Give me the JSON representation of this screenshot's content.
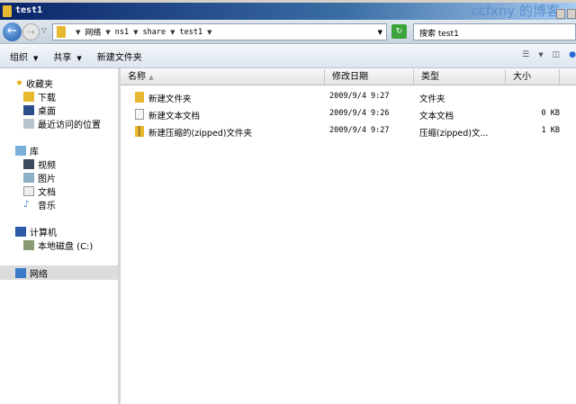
{
  "window": {
    "title": "test1",
    "watermark": "ccfxny 的博客"
  },
  "address": {
    "segments": [
      "网络",
      "ns1",
      "share",
      "test1"
    ],
    "search_placeholder": "搜索 test1"
  },
  "toolbar": {
    "organize": "组织",
    "share": "共享",
    "new_folder": "新建文件夹"
  },
  "nav": {
    "favorites": "收藏夹",
    "downloads": "下载",
    "desktop": "桌面",
    "recent": "最近访问的位置",
    "libraries": "库",
    "videos": "视频",
    "pictures": "图片",
    "documents": "文档",
    "music": "音乐",
    "computer": "计算机",
    "local_disk": "本地磁盘 (C:)",
    "network": "网络"
  },
  "columns": {
    "name": "名称",
    "date": "修改日期",
    "type": "类型",
    "size": "大小"
  },
  "files": [
    {
      "name": "新建文件夹",
      "date": "2009/9/4 9:27",
      "type": "文件夹",
      "size": ""
    },
    {
      "name": "新建文本文档",
      "date": "2009/9/4 9:26",
      "type": "文本文档",
      "size": "0 KB"
    },
    {
      "name": "新建压缩的(zipped)文件夹",
      "date": "2009/9/4 9:27",
      "type": "压缩(zipped)文...",
      "size": "1 KB"
    }
  ]
}
